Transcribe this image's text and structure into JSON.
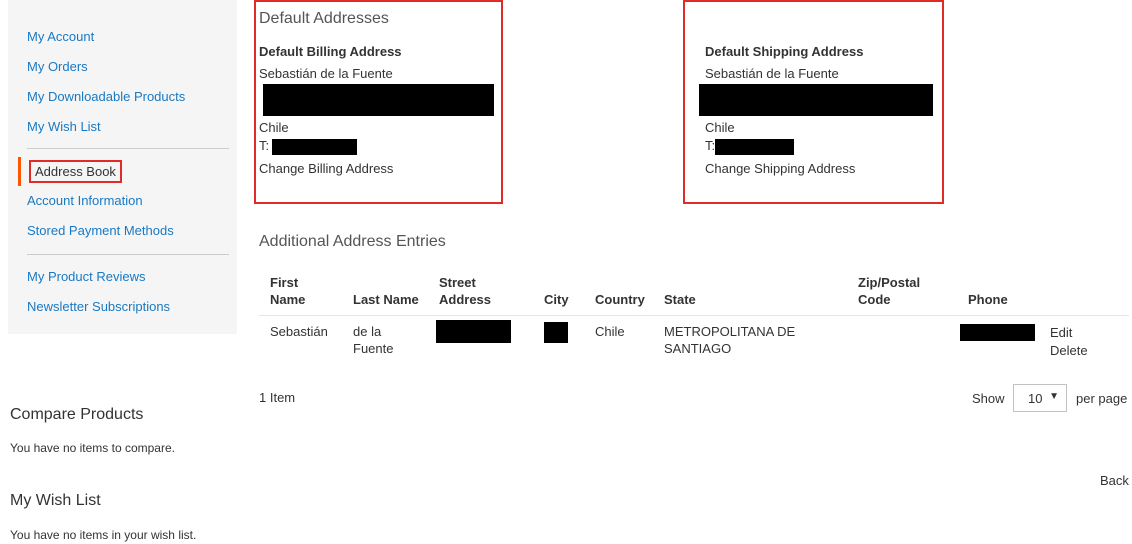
{
  "sidebar": {
    "nav_group1": [
      "My Account",
      "My Orders",
      "My Downloadable Products",
      "My Wish List"
    ],
    "current": "Address Book",
    "nav_group2": [
      "Account Information",
      "Stored Payment Methods"
    ],
    "nav_group3": [
      "My Product Reviews",
      "Newsletter Subscriptions"
    ],
    "compare": {
      "title": "Compare Products",
      "empty": "You have no items to compare."
    },
    "wishlist": {
      "title": "My Wish List",
      "empty": "You have no items in your wish list."
    }
  },
  "default_addresses": {
    "title": "Default Addresses",
    "billing": {
      "title": "Default Billing Address",
      "name": "Sebastián de la Fuente",
      "country": "Chile",
      "phone_prefix": "T:",
      "action": "Change Billing Address"
    },
    "shipping": {
      "title": "Default Shipping Address",
      "name": "Sebastián de la Fuente",
      "country": "Chile",
      "phone_prefix": "T:",
      "action": "Change Shipping Address"
    }
  },
  "additional": {
    "title": "Additional Address Entries",
    "headers": {
      "first_name_1": "First",
      "first_name_2": "Name",
      "last_name": "Last Name",
      "street_1": "Street",
      "street_2": "Address",
      "city": "City",
      "country": "Country",
      "state": "State",
      "zip_1": "Zip/Postal",
      "zip_2": "Code",
      "phone": "Phone"
    },
    "row": {
      "first_name": "Sebastián",
      "last_name_1": "de la",
      "last_name_2": "Fuente",
      "country": "Chile",
      "state_1": "METROPOLITANA DE",
      "state_2": "SANTIAGO",
      "edit": "Edit",
      "delete": "Delete"
    }
  },
  "toolbar": {
    "count": "1 Item",
    "show": "Show",
    "limit": "10",
    "per_page": "per page"
  },
  "back": "Back"
}
